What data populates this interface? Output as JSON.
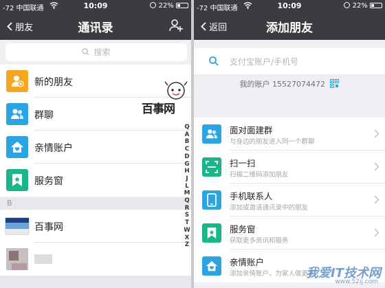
{
  "left": {
    "status": {
      "carrier": "-72 中国联通",
      "time": "10:09",
      "battery": "22%"
    },
    "nav": {
      "back": "朋友",
      "title": "通讯录"
    },
    "search": {
      "placeholder": "搜索"
    },
    "items": [
      {
        "label": "新的朋友",
        "icon": "new-friend-icon",
        "color": "#f5a623"
      },
      {
        "label": "群聊",
        "icon": "group-chat-icon",
        "color": "#2aa4e2"
      },
      {
        "label": "亲情账户",
        "icon": "family-account-icon",
        "color": "#2aa4e2"
      },
      {
        "label": "服务窗",
        "icon": "service-window-icon",
        "color": "#1bb58a"
      }
    ],
    "section": "B",
    "contacts": [
      {
        "name": "百事网"
      }
    ],
    "index": [
      "Q",
      "A",
      "B",
      "C",
      "D",
      "G",
      "H",
      "J",
      "L",
      "M",
      "Q",
      "R",
      "S",
      "T",
      "W",
      "X",
      "Z"
    ],
    "watermark": {
      "text": "百事网",
      "sub": "www.pc841.com"
    }
  },
  "right": {
    "status": {
      "carrier": "-72 中国联通",
      "time": "10:09",
      "battery": "22%"
    },
    "nav": {
      "back": "返回",
      "title": "添加朋友"
    },
    "search": {
      "placeholder": "支付宝账户/手机号"
    },
    "account": "我的账户 15527074472",
    "items": [
      {
        "title": "面对面建群",
        "desc": "与身边的朋友进入同一个群聊",
        "icon": "face-to-face-group-icon"
      },
      {
        "title": "扫一扫",
        "desc": "扫描二维码添加朋友",
        "icon": "scan-icon"
      },
      {
        "title": "手机联系人",
        "desc": "添加或邀请通讯录中的朋友",
        "icon": "phone-contacts-icon"
      },
      {
        "title": "服务窗",
        "desc": "获取更多资讯和服务",
        "icon": "service-window-icon"
      },
      {
        "title": "亲情账户",
        "desc": "添加亲情账户，为家人做更多",
        "icon": "family-account-icon"
      }
    ],
    "watermark": {
      "text": "我爱IT技术网",
      "sub": "www.52ij.com"
    }
  },
  "colors": {
    "navbar": "#3b3c40",
    "accent_blue": "#2aa4e2",
    "orange": "#f5a623",
    "green": "#1bb58a"
  }
}
